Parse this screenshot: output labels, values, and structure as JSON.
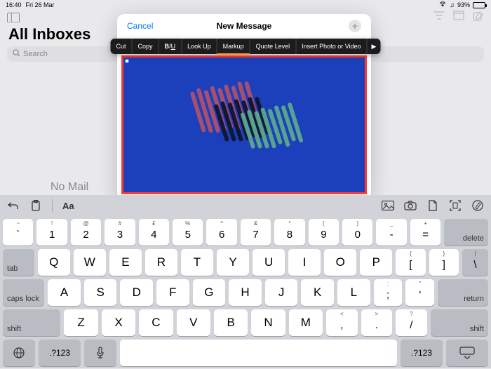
{
  "status": {
    "time": "16:40",
    "date": "Fri 26 Mar",
    "battery_pct": "93%"
  },
  "mail": {
    "title": "All Inboxes",
    "search_placeholder": "Search",
    "empty_state": "No Mail"
  },
  "compose": {
    "cancel": "Cancel",
    "title": "New Message",
    "popover": {
      "cut": "Cut",
      "copy": "Copy",
      "biu_b": "B",
      "biu_i": "I",
      "biu_u": "U",
      "lookup": "Look Up",
      "markup": "Markup",
      "quote": "Quote Level",
      "insert": "Insert Photo or Video"
    }
  },
  "keyboard": {
    "toolbar": {
      "aa": "Aa"
    },
    "row1_sup": [
      "~",
      "!",
      "@",
      "#",
      "£",
      "%",
      "^",
      "&",
      "*",
      "(",
      ")",
      "_",
      "+"
    ],
    "row1_main": [
      "`",
      "1",
      "2",
      "3",
      "4",
      "5",
      "6",
      "7",
      "8",
      "9",
      "0",
      "-",
      "="
    ],
    "delete": "delete",
    "tab": "tab",
    "row2": [
      "Q",
      "W",
      "E",
      "R",
      "T",
      "Y",
      "U",
      "I",
      "O",
      "P"
    ],
    "brackets1": [
      "{",
      "["
    ],
    "brackets2": [
      "}",
      "]"
    ],
    "capslock": "caps lock",
    "row3": [
      "A",
      "S",
      "D",
      "F",
      "G",
      "H",
      "J",
      "K",
      "L"
    ],
    "semi": [
      ":",
      ";"
    ],
    "quote": [
      "\"",
      "'"
    ],
    "return": "return",
    "shift": "shift",
    "row4": [
      "Z",
      "X",
      "C",
      "V",
      "B",
      "N",
      "M"
    ],
    "comma": [
      "<",
      ","
    ],
    "period": [
      ">",
      "."
    ],
    "slash": [
      "?",
      "/"
    ],
    "sym": ".?123"
  }
}
